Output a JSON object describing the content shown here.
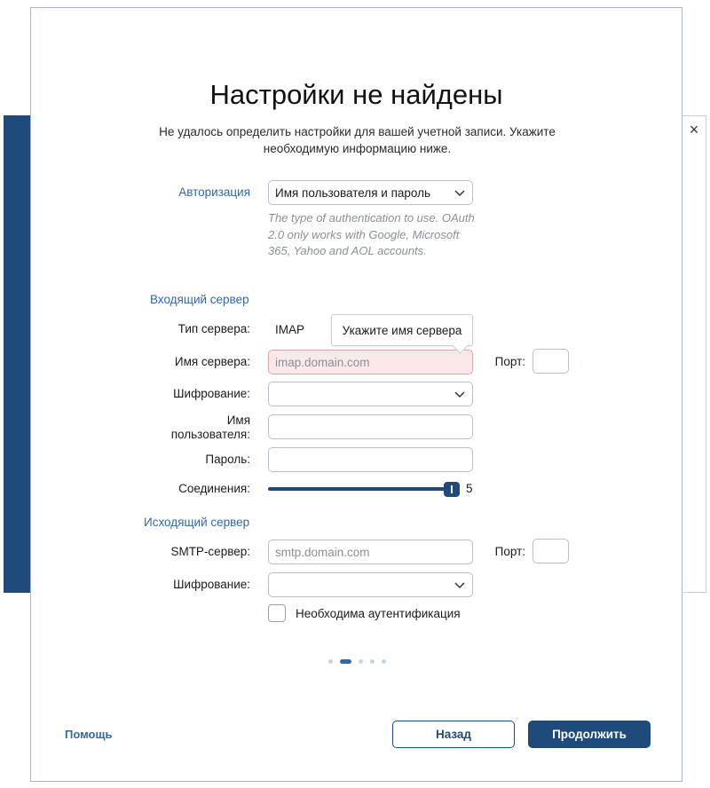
{
  "background": {
    "close_icon": "×"
  },
  "dialog": {
    "title": "Настройки не найдены",
    "subtitle": "Не удалось определить настройки для вашей учетной записи. Укажите необходимую информацию ниже.",
    "auth": {
      "label": "Авторизация",
      "value": "Имя пользователя и пароль",
      "hint": "The type of authentication to use. OAuth 2.0 only works with Google, Microsoft 365, Yahoo and AOL accounts."
    },
    "incoming": {
      "section": "Входящий сервер",
      "server_type_label": "Тип сервера:",
      "server_type_value": "IMAP",
      "server_name_label": "Имя сервера:",
      "server_name_placeholder": "imap.domain.com",
      "tooltip": "Укажите имя сервера",
      "port_label": "Порт:",
      "encryption_label": "Шифрование:",
      "username_label_line1": "Имя",
      "username_label_line2": "пользователя:",
      "password_label": "Пароль:",
      "connections_label": "Соединения:",
      "connections_value": "5"
    },
    "outgoing": {
      "section": "Исходящий сервер",
      "smtp_label": "SMTP-сервер:",
      "smtp_placeholder": "smtp.domain.com",
      "port_label": "Порт:",
      "encryption_label": "Шифрование:",
      "auth_required_label": "Необходима аутентификация"
    },
    "pager": {
      "total": 5,
      "current": 2
    },
    "footer": {
      "help": "Помощь",
      "back": "Назад",
      "continue": "Продолжить"
    }
  },
  "colors": {
    "accent": "#1f4a7c",
    "link": "#2f6aa8",
    "error_bg": "#fbe9e9"
  }
}
